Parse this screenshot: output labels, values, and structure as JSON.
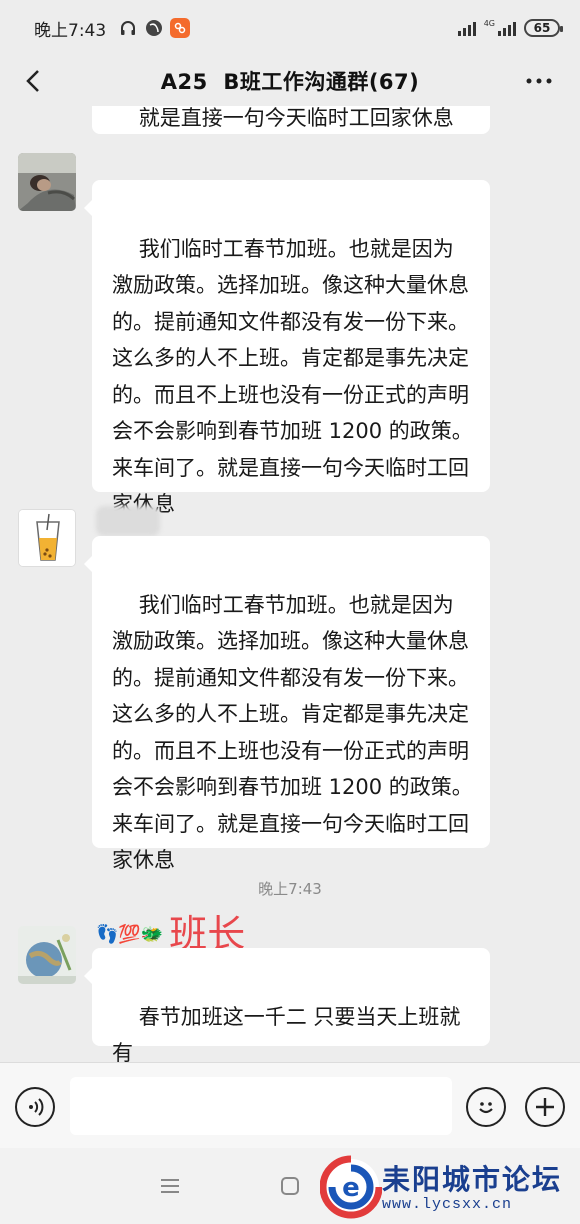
{
  "status_bar": {
    "time": "晚上7:43",
    "network_label": "4G",
    "battery": "65",
    "icons": [
      "headphones-icon",
      "vpn-globe-icon",
      "app-notification-icon",
      "signal-icon",
      "signal-4g-icon",
      "battery-icon"
    ]
  },
  "header": {
    "title": "A25  B班工作沟通群(67)",
    "back_icon": "back-chevron-icon",
    "more_icon": "more-dots-icon"
  },
  "messages": {
    "top_partial": "就是直接一句今天临时工回家休息",
    "msg1": {
      "sender": "",
      "text": "我们临时工春节加班。也就是因为激励政策。选择加班。像这种大量休息的。提前通知文件都没有发一份下来。这么多的人不上班。肯定都是事先决定的。而且不上班也没有一份正式的声明会不会影响到春节加班 1200 的政策。来车间了。就是直接一句今天临时工回家休息"
    },
    "msg2": {
      "sender": "",
      "text": "我们临时工春节加班。也就是因为激励政策。选择加班。像这种大量休息的。提前通知文件都没有发一份下来。这么多的人不上班。肯定都是事先决定的。而且不上班也没有一份正式的声明会不会影响到春节加班 1200 的政策。来车间了。就是直接一句今天临时工回家休息"
    },
    "time_divider": "晚上7:43",
    "msg3": {
      "sender_emoji": "👣💯🐲",
      "sender_title": "班长",
      "text": "春节加班这一千二 只要当天上班就有"
    }
  },
  "input_bar": {
    "placeholder": "",
    "voice_icon": "voice-icon",
    "emoji_icon": "emoji-icon",
    "plus_icon": "plus-icon"
  },
  "nav_bar": {
    "menu_icon": "menu-lines-icon",
    "home_icon": "home-square-icon"
  },
  "watermark": {
    "name": "耒阳城市论坛",
    "url": "www.lycsxx.cn"
  },
  "colors": {
    "background": "#ededed",
    "bubble": "#ffffff",
    "title_red": "#e8474c",
    "watermark_blue": "#1a3f8f"
  }
}
